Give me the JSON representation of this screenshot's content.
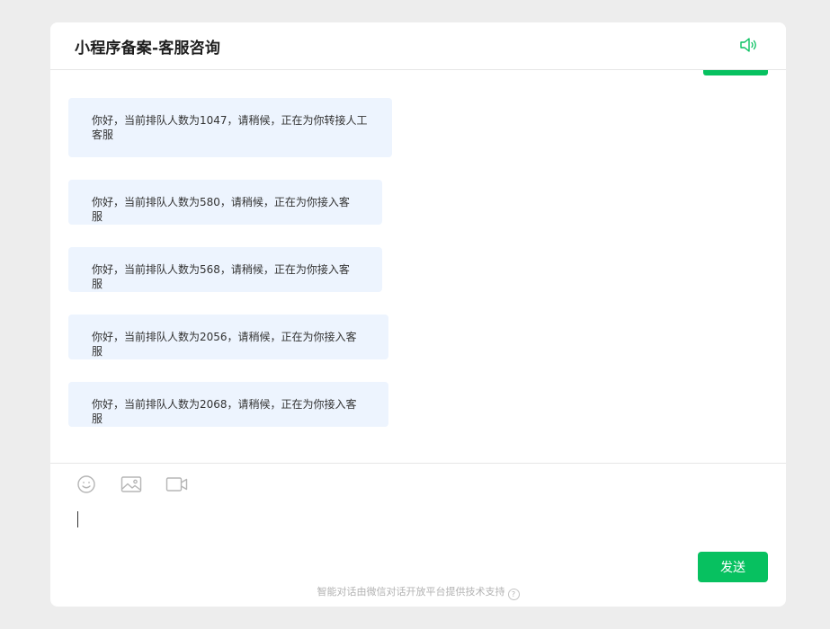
{
  "header": {
    "title": "小程序备案-客服咨询",
    "speaker_icon": "speaker-icon"
  },
  "messages": [
    {
      "text": "你好，当前排队人数为1047，请稍候，正在为你转接人工客服"
    },
    {
      "text": "你好，当前排队人数为580，请稍候，正在为你接入客服"
    },
    {
      "text": "你好，当前排队人数为568，请稍候，正在为你接入客服"
    },
    {
      "text": "你好，当前排队人数为2056，请稍候，正在为你接入客服"
    },
    {
      "text": "你好，当前排队人数为2068，请稍候，正在为你接入客服"
    }
  ],
  "toolbar": {
    "icons": [
      "emoji-icon",
      "image-icon",
      "video-icon"
    ]
  },
  "input": {
    "value": "",
    "placeholder": ""
  },
  "send_label": "发送",
  "footer_text": "智能对话由微信对话开放平台提供技术支持",
  "footer_help": "?",
  "colors": {
    "accent": "#07c160",
    "bubble": "#edf4fe",
    "background": "#ededed"
  }
}
